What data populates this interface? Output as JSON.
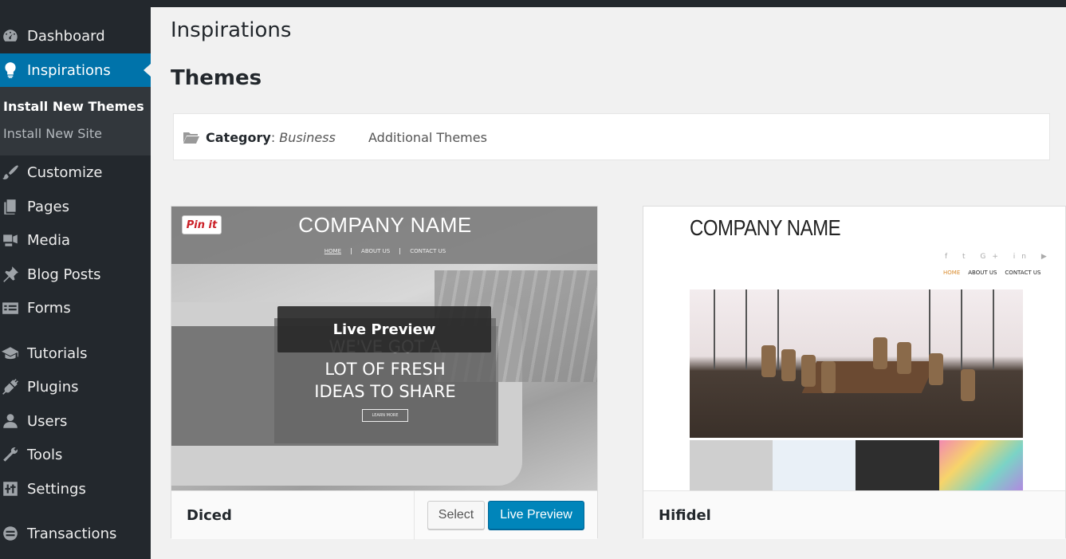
{
  "sidebar": {
    "items": [
      {
        "label": "Dashboard",
        "icon": "dashboard-icon"
      },
      {
        "label": "Inspirations",
        "icon": "lightbulb-icon",
        "active": true
      },
      {
        "label": "Customize",
        "icon": "paintbrush-icon"
      },
      {
        "label": "Pages",
        "icon": "pages-icon"
      },
      {
        "label": "Media",
        "icon": "media-icon"
      },
      {
        "label": "Blog Posts",
        "icon": "pin-icon"
      },
      {
        "label": "Forms",
        "icon": "forms-icon"
      },
      {
        "label": "Tutorials",
        "icon": "graduation-cap-icon"
      },
      {
        "label": "Plugins",
        "icon": "plugin-icon"
      },
      {
        "label": "Users",
        "icon": "users-icon"
      },
      {
        "label": "Tools",
        "icon": "wrench-icon"
      },
      {
        "label": "Settings",
        "icon": "settings-icon"
      },
      {
        "label": "Transactions",
        "icon": "transactions-icon"
      }
    ],
    "submenu": {
      "current": "Install New Themes",
      "other": "Install New Site"
    }
  },
  "page": {
    "title": "Inspirations",
    "section_title": "Themes"
  },
  "filter": {
    "category_label": "Category",
    "category_value": "Business",
    "additional": "Additional Themes"
  },
  "themes": [
    {
      "name": "Diced",
      "select_label": "Select",
      "preview_label": "Live Preview",
      "overlay_label": "Live Preview",
      "preview": {
        "pin_label": "Pin it",
        "company": "COMPANY NAME",
        "nav": [
          "HOME",
          "ABOUT US",
          "CONTACT US"
        ],
        "hero_line1": "WE'VE GOT A",
        "hero_line2": "LOT OF FRESH",
        "hero_line3": "IDEAS TO SHARE",
        "hero_button": "LEARN MORE"
      }
    },
    {
      "name": "Hifidel",
      "preview": {
        "company": "COMPANY NAME",
        "social": "f  t  G+  in  ▶",
        "nav": [
          "HOME",
          "ABOUT US",
          "CONTACT US"
        ]
      }
    }
  ],
  "colors": {
    "sidebar_bg": "#23282d",
    "active_bg": "#0073aa",
    "primary_button": "#0085ba"
  }
}
